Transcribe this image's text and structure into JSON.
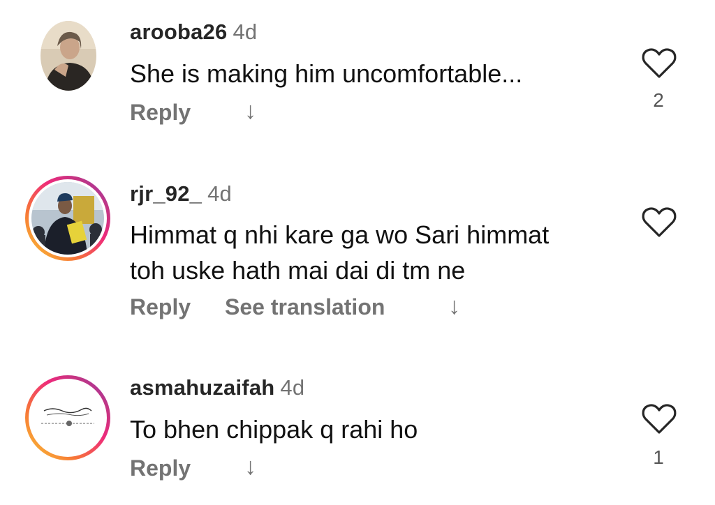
{
  "comments": [
    {
      "username": "arooba26",
      "time": "4d",
      "text": "She is making him uncomfortable...",
      "reply_label": "Reply",
      "likes": "2",
      "avatar_ring": false
    },
    {
      "username": "rjr_92_",
      "time": "4d",
      "text_line1": "Himmat q nhi kare ga wo Sari himmat",
      "text_line2": "toh uske hath mai dai di tm ne",
      "reply_label": "Reply",
      "translate_label": "See translation",
      "avatar_ring": true
    },
    {
      "username": "asmahuzaifah",
      "time": "4d",
      "text": "To bhen chippak q rahi ho",
      "reply_label": "Reply",
      "likes": "1",
      "avatar_ring": true
    }
  ],
  "icons": {
    "like": "heart-outline-icon",
    "view_replies": "arrow-down-icon"
  },
  "colors": {
    "secondary_text": "#737373",
    "ring_gradient_start": "#f9ce34",
    "ring_gradient_end": "#8a3ab9"
  }
}
